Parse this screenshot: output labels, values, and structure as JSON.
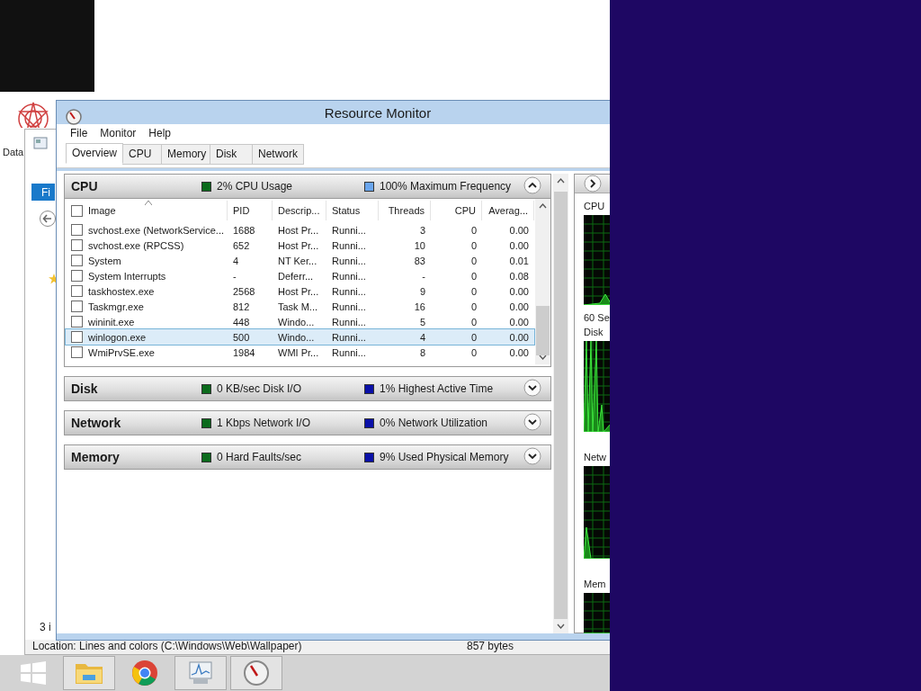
{
  "desktop_icon": {
    "label": "Data"
  },
  "explorer": {
    "ribbon_tab": "Fi",
    "item_count": "3 i",
    "status_location": "Location: Lines and colors (C:\\Windows\\Web\\Wallpaper)",
    "status_size": "857 bytes"
  },
  "window": {
    "title": "Resource Monitor"
  },
  "menu": [
    "File",
    "Monitor",
    "Help"
  ],
  "tabs": [
    {
      "label": "Overview",
      "selected": true
    },
    {
      "label": "CPU",
      "selected": false
    },
    {
      "label": "Memory",
      "selected": false
    },
    {
      "label": "Disk",
      "selected": false
    },
    {
      "label": "Network",
      "selected": false
    }
  ],
  "sections": [
    {
      "title": "CPU",
      "expanded": true,
      "metrics": [
        {
          "text": "2% CPU Usage",
          "color": "#0b6b1c"
        },
        {
          "text": "100% Maximum Frequency",
          "color": "#6aa6ee"
        }
      ]
    },
    {
      "title": "Disk",
      "expanded": false,
      "metrics": [
        {
          "text": "0 KB/sec Disk I/O",
          "color": "#0b6b1c"
        },
        {
          "text": "1% Highest Active Time",
          "color": "#0a10a8"
        }
      ]
    },
    {
      "title": "Network",
      "expanded": false,
      "metrics": [
        {
          "text": "1 Kbps Network I/O",
          "color": "#0b6b1c"
        },
        {
          "text": "0% Network Utilization",
          "color": "#0a10a8"
        }
      ]
    },
    {
      "title": "Memory",
      "expanded": false,
      "metrics": [
        {
          "text": "0 Hard Faults/sec",
          "color": "#0b6b1c"
        },
        {
          "text": "9% Used Physical Memory",
          "color": "#0a10a8"
        }
      ]
    }
  ],
  "cpu_table": {
    "select_all_checked": false,
    "columns": [
      "Image",
      "PID",
      "Descrip...",
      "Status",
      "Threads",
      "CPU",
      "Averag..."
    ],
    "rows": [
      {
        "checked": false,
        "selected": false,
        "cells": [
          "svchost.exe (NetworkService...",
          "1688",
          "Host Pr...",
          "Runni...",
          "3",
          "0",
          "0.00"
        ]
      },
      {
        "checked": false,
        "selected": false,
        "cells": [
          "svchost.exe (RPCSS)",
          "652",
          "Host Pr...",
          "Runni...",
          "10",
          "0",
          "0.00"
        ]
      },
      {
        "checked": false,
        "selected": false,
        "cells": [
          "System",
          "4",
          "NT Ker...",
          "Runni...",
          "83",
          "0",
          "0.01"
        ]
      },
      {
        "checked": false,
        "selected": false,
        "cells": [
          "System Interrupts",
          "-",
          "Deferr...",
          "Runni...",
          "-",
          "0",
          "0.08"
        ]
      },
      {
        "checked": false,
        "selected": false,
        "cells": [
          "taskhostex.exe",
          "2568",
          "Host Pr...",
          "Runni...",
          "9",
          "0",
          "0.00"
        ]
      },
      {
        "checked": false,
        "selected": false,
        "cells": [
          "Taskmgr.exe",
          "812",
          "Task M...",
          "Runni...",
          "16",
          "0",
          "0.00"
        ]
      },
      {
        "checked": false,
        "selected": false,
        "cells": [
          "wininit.exe",
          "448",
          "Windo...",
          "Runni...",
          "5",
          "0",
          "0.00"
        ]
      },
      {
        "checked": false,
        "selected": true,
        "cells": [
          "winlogon.exe",
          "500",
          "Windo...",
          "Runni...",
          "4",
          "0",
          "0.00"
        ]
      },
      {
        "checked": false,
        "selected": false,
        "cells": [
          "WmiPrvSE.exe",
          "1984",
          "WMI Pr...",
          "Runni...",
          "8",
          "0",
          "0.00"
        ]
      }
    ]
  },
  "graphs": [
    {
      "label": "CPU"
    },
    {
      "label": "60 Se"
    },
    {
      "label": "Disk"
    },
    {
      "label": "Netw"
    },
    {
      "label": "Mem"
    }
  ],
  "taskbar": [
    {
      "kind": "start",
      "open": false
    },
    {
      "kind": "folder",
      "open": true
    },
    {
      "kind": "browser",
      "open": false
    },
    {
      "kind": "monitor",
      "open": true
    },
    {
      "kind": "gauge",
      "open": true
    }
  ]
}
